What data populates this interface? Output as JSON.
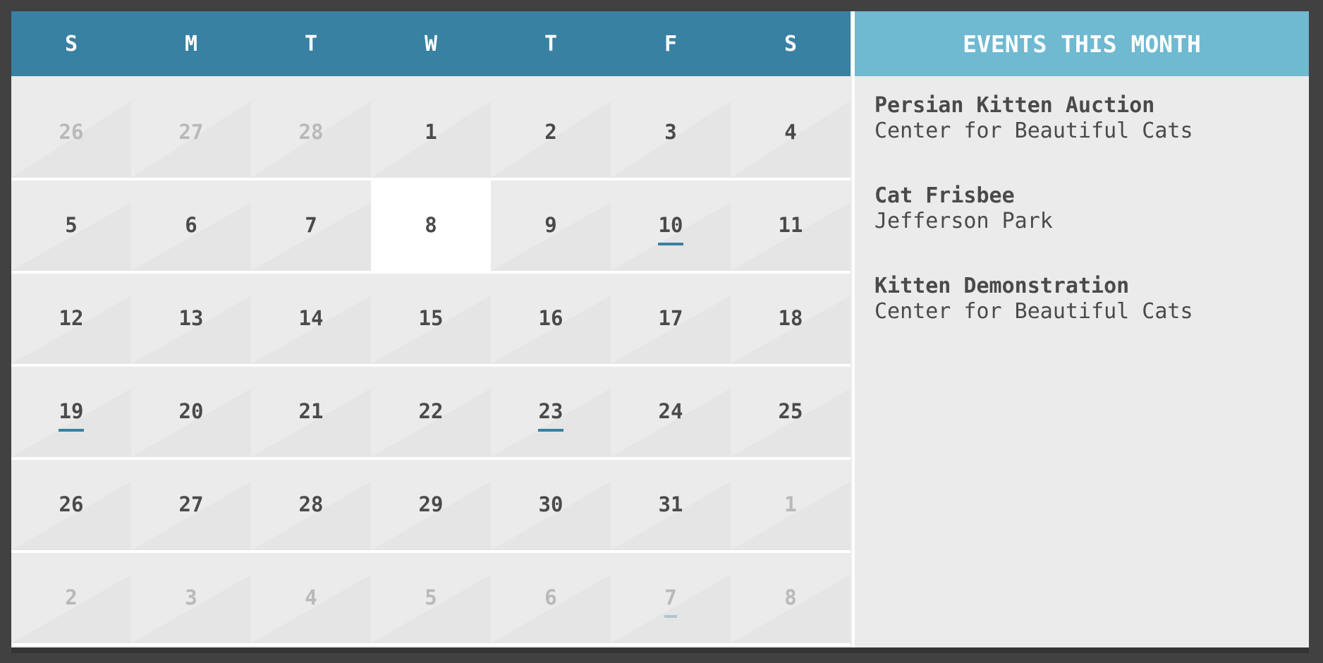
{
  "calendar": {
    "weekdays": [
      "S",
      "M",
      "T",
      "W",
      "T",
      "F",
      "S"
    ],
    "weeks": [
      [
        {
          "day": "26",
          "current_month": false,
          "has_event": false,
          "today": false
        },
        {
          "day": "27",
          "current_month": false,
          "has_event": false,
          "today": false
        },
        {
          "day": "28",
          "current_month": false,
          "has_event": false,
          "today": false
        },
        {
          "day": "1",
          "current_month": true,
          "has_event": false,
          "today": false
        },
        {
          "day": "2",
          "current_month": true,
          "has_event": false,
          "today": false
        },
        {
          "day": "3",
          "current_month": true,
          "has_event": false,
          "today": false
        },
        {
          "day": "4",
          "current_month": true,
          "has_event": false,
          "today": false
        }
      ],
      [
        {
          "day": "5",
          "current_month": true,
          "has_event": false,
          "today": false
        },
        {
          "day": "6",
          "current_month": true,
          "has_event": false,
          "today": false
        },
        {
          "day": "7",
          "current_month": true,
          "has_event": false,
          "today": false
        },
        {
          "day": "8",
          "current_month": true,
          "has_event": false,
          "today": true
        },
        {
          "day": "9",
          "current_month": true,
          "has_event": false,
          "today": false
        },
        {
          "day": "10",
          "current_month": true,
          "has_event": true,
          "today": false
        },
        {
          "day": "11",
          "current_month": true,
          "has_event": false,
          "today": false
        }
      ],
      [
        {
          "day": "12",
          "current_month": true,
          "has_event": false,
          "today": false
        },
        {
          "day": "13",
          "current_month": true,
          "has_event": false,
          "today": false
        },
        {
          "day": "14",
          "current_month": true,
          "has_event": false,
          "today": false
        },
        {
          "day": "15",
          "current_month": true,
          "has_event": false,
          "today": false
        },
        {
          "day": "16",
          "current_month": true,
          "has_event": false,
          "today": false
        },
        {
          "day": "17",
          "current_month": true,
          "has_event": false,
          "today": false
        },
        {
          "day": "18",
          "current_month": true,
          "has_event": false,
          "today": false
        }
      ],
      [
        {
          "day": "19",
          "current_month": true,
          "has_event": true,
          "today": false
        },
        {
          "day": "20",
          "current_month": true,
          "has_event": false,
          "today": false
        },
        {
          "day": "21",
          "current_month": true,
          "has_event": false,
          "today": false
        },
        {
          "day": "22",
          "current_month": true,
          "has_event": false,
          "today": false
        },
        {
          "day": "23",
          "current_month": true,
          "has_event": true,
          "today": false
        },
        {
          "day": "24",
          "current_month": true,
          "has_event": false,
          "today": false
        },
        {
          "day": "25",
          "current_month": true,
          "has_event": false,
          "today": false
        }
      ],
      [
        {
          "day": "26",
          "current_month": true,
          "has_event": false,
          "today": false
        },
        {
          "day": "27",
          "current_month": true,
          "has_event": false,
          "today": false
        },
        {
          "day": "28",
          "current_month": true,
          "has_event": false,
          "today": false
        },
        {
          "day": "29",
          "current_month": true,
          "has_event": false,
          "today": false
        },
        {
          "day": "30",
          "current_month": true,
          "has_event": false,
          "today": false
        },
        {
          "day": "31",
          "current_month": true,
          "has_event": false,
          "today": false
        },
        {
          "day": "1",
          "current_month": false,
          "has_event": false,
          "today": false
        }
      ],
      [
        {
          "day": "2",
          "current_month": false,
          "has_event": false,
          "today": false
        },
        {
          "day": "3",
          "current_month": false,
          "has_event": false,
          "today": false
        },
        {
          "day": "4",
          "current_month": false,
          "has_event": false,
          "today": false
        },
        {
          "day": "5",
          "current_month": false,
          "has_event": false,
          "today": false
        },
        {
          "day": "6",
          "current_month": false,
          "has_event": false,
          "today": false
        },
        {
          "day": "7",
          "current_month": false,
          "has_event": true,
          "today": false
        },
        {
          "day": "8",
          "current_month": false,
          "has_event": false,
          "today": false
        }
      ]
    ]
  },
  "events": {
    "header": "EVENTS THIS MONTH",
    "items": [
      {
        "title": "Persian Kitten Auction",
        "location": "Center for Beautiful Cats"
      },
      {
        "title": "Cat Frisbee",
        "location": "Jefferson Park"
      },
      {
        "title": "Kitten Demonstration",
        "location": "Center for Beautiful Cats"
      }
    ]
  },
  "colors": {
    "calendar_header": "#3881a3",
    "events_header": "#6fb9d1",
    "event_marker": "#3881a3",
    "today_background": "#ffffff",
    "page_background": "#414141"
  }
}
